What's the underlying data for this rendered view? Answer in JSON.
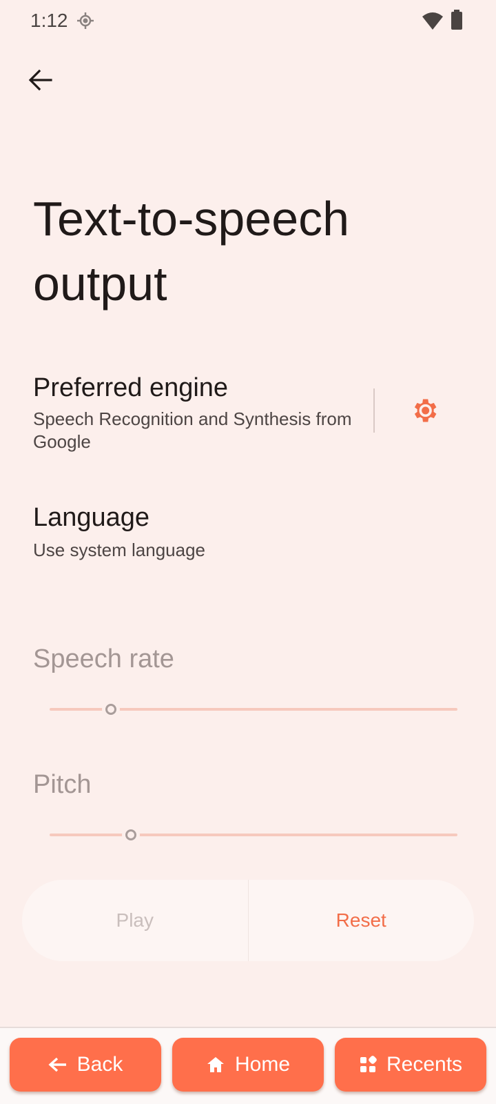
{
  "status_bar": {
    "time": "1:12",
    "icons": [
      "location-icon",
      "wifi-icon",
      "battery-icon"
    ]
  },
  "header": {
    "back_icon": "arrow-left-icon",
    "title": "Text-to-speech output"
  },
  "preferred_engine": {
    "title": "Preferred engine",
    "subtitle": "Speech Recognition and Synthesis from Google",
    "settings_icon": "gear-icon"
  },
  "language": {
    "title": "Language",
    "subtitle": "Use system language"
  },
  "speech_rate": {
    "label": "Speech rate",
    "value_fraction": 0.15
  },
  "pitch": {
    "label": "Pitch",
    "value_fraction": 0.2
  },
  "actions": {
    "play_label": "Play",
    "reset_label": "Reset"
  },
  "nav": {
    "back_label": "Back",
    "home_label": "Home",
    "recents_label": "Recents"
  },
  "colors": {
    "background": "#fcefec",
    "accent": "#ff6f4b",
    "accent_text": "#f26d48",
    "disabled_text": "#a39694"
  }
}
